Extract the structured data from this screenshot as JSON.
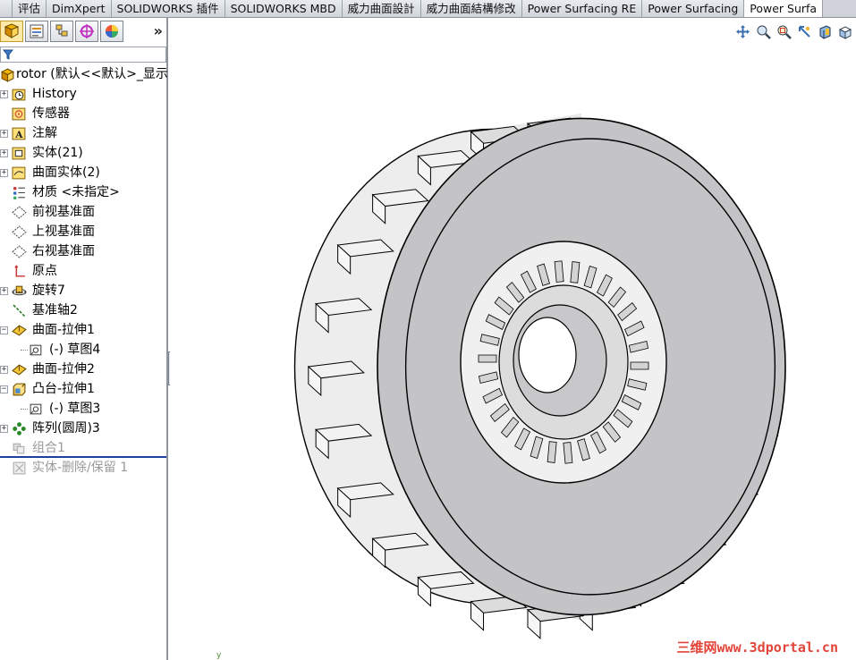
{
  "tabs": [
    {
      "label": "评估"
    },
    {
      "label": "DimXpert"
    },
    {
      "label": "SOLIDWORKS 插件"
    },
    {
      "label": "SOLIDWORKS MBD"
    },
    {
      "label": "威力曲面設計"
    },
    {
      "label": "威力曲面結構修改"
    },
    {
      "label": "Power Surfacing RE"
    },
    {
      "label": "Power Surfacing"
    },
    {
      "label": "Power Surfa"
    }
  ],
  "active_tab_index": 8,
  "panel": {
    "tabs": [
      {
        "icon": "feature-manager-icon"
      },
      {
        "icon": "property-manager-icon"
      },
      {
        "icon": "configuration-manager-icon"
      },
      {
        "icon": "dimxpert-manager-icon"
      },
      {
        "icon": "display-manager-icon"
      }
    ],
    "expand_label": "»"
  },
  "tree": {
    "root": {
      "label": "rotor  (默认<<默认>_显示"
    },
    "items": [
      {
        "label": "History",
        "icon": "history-icon",
        "expandable": true
      },
      {
        "label": "传感器",
        "icon": "sensor-icon",
        "expandable": false
      },
      {
        "label": "注解",
        "icon": "annotation-icon",
        "expandable": true
      },
      {
        "label": "实体(21)",
        "icon": "solid-bodies-icon",
        "expandable": true
      },
      {
        "label": "曲面实体(2)",
        "icon": "surface-bodies-icon",
        "expandable": true
      },
      {
        "label": "材质 <未指定>",
        "icon": "material-icon",
        "expandable": false
      },
      {
        "label": "前视基准面",
        "icon": "plane-icon",
        "expandable": false
      },
      {
        "label": "上视基准面",
        "icon": "plane-icon",
        "expandable": false
      },
      {
        "label": "右视基准面",
        "icon": "plane-icon",
        "expandable": false
      },
      {
        "label": "原点",
        "icon": "origin-icon",
        "expandable": false
      },
      {
        "label": "旋转7",
        "icon": "revolve-icon",
        "expandable": true
      },
      {
        "label": "基准轴2",
        "icon": "axis-icon",
        "expandable": false
      },
      {
        "label": "曲面-拉伸1",
        "icon": "surface-extrude-icon",
        "expandable": true,
        "expanded": true
      },
      {
        "label": "(-) 草图4",
        "icon": "sketch-icon",
        "child": true
      },
      {
        "label": "曲面-拉伸2",
        "icon": "surface-extrude-icon",
        "expandable": true
      },
      {
        "label": "凸台-拉伸1",
        "icon": "boss-extrude-icon",
        "expandable": true,
        "expanded": true
      },
      {
        "label": "(-) 草图3",
        "icon": "sketch-icon",
        "child": true
      },
      {
        "label": "阵列(圆周)3",
        "icon": "circular-pattern-icon",
        "expandable": true
      },
      {
        "label": "组合1",
        "icon": "combine-icon",
        "suppressed": true
      },
      {
        "label": "实体-删除/保留 1",
        "icon": "delete-body-icon",
        "suppressed": true
      }
    ]
  },
  "view_toolbar": [
    {
      "icon": "pan-icon"
    },
    {
      "icon": "zoom-to-fit-icon"
    },
    {
      "icon": "zoom-to-area-icon"
    },
    {
      "icon": "previous-view-icon"
    },
    {
      "icon": "section-view-icon"
    },
    {
      "icon": "view-orientation-icon"
    }
  ],
  "watermark": "三维网www.3dportal.cn",
  "colors": {
    "model_face": "#c4c4c6",
    "model_light": "#f2f2f2",
    "model_edge": "#000000",
    "rollback_bar": "#1f3f9a",
    "watermark": "#e3443a"
  }
}
